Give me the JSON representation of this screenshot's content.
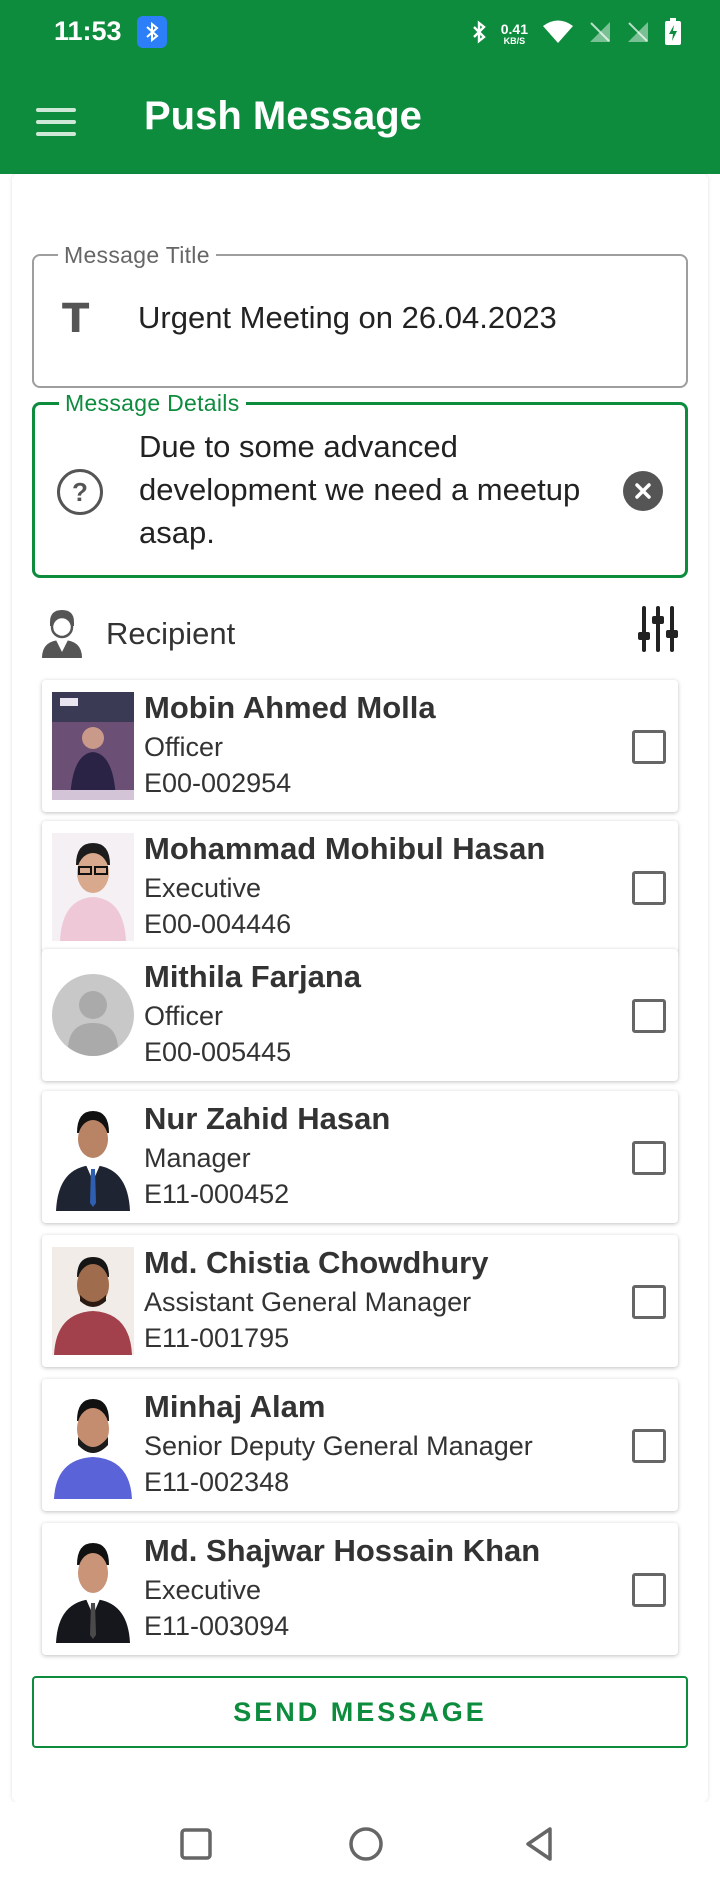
{
  "status_bar": {
    "time": "11:53",
    "network_speed_value": "0.41",
    "network_speed_unit": "KB/S"
  },
  "app_bar": {
    "title": "Push Message"
  },
  "form": {
    "title_field": {
      "legend": "Message Title",
      "value": "Urgent Meeting on 26.04.2023"
    },
    "details_field": {
      "legend": "Message Details",
      "value": "Due to some advanced development we need a meetup asap."
    }
  },
  "recipient": {
    "label": "Recipient"
  },
  "recipients": [
    {
      "name": "Mobin Ahmed Molla",
      "role": "Officer",
      "code": "E00-002954"
    },
    {
      "name": "Mohammad Mohibul Hasan",
      "role": "Executive",
      "code": "E00-004446"
    },
    {
      "name": "Mithila Farjana",
      "role": "Officer",
      "code": "E00-005445"
    },
    {
      "name": "Nur Zahid Hasan",
      "role": "Manager",
      "code": "E11-000452"
    },
    {
      "name": "Md. Chistia Chowdhury",
      "role": "Assistant General Manager",
      "code": "E11-001795"
    },
    {
      "name": "Minhaj Alam",
      "role": "Senior Deputy General Manager",
      "code": "E11-002348"
    },
    {
      "name": "Md. Shajwar Hossain Khan",
      "role": "Executive",
      "code": "E11-003094"
    }
  ],
  "actions": {
    "send_label": "SEND MESSAGE"
  },
  "colors": {
    "brand": "#0d8c3e",
    "text": "#333333"
  }
}
